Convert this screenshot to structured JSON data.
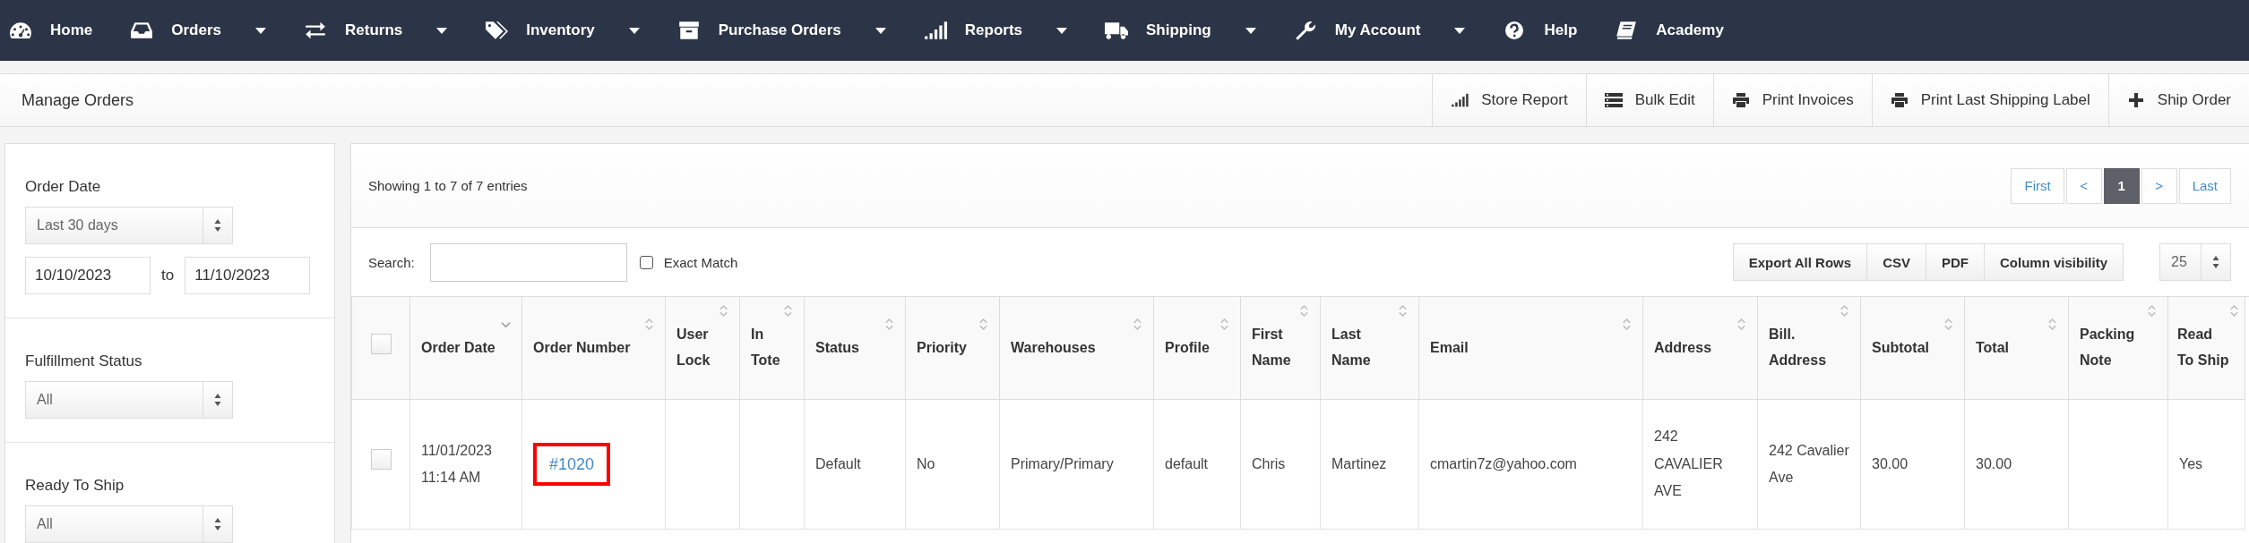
{
  "nav": [
    {
      "label": "Home",
      "dropdown": false
    },
    {
      "label": "Orders",
      "dropdown": true
    },
    {
      "label": "Returns",
      "dropdown": true
    },
    {
      "label": "Inventory",
      "dropdown": true
    },
    {
      "label": "Purchase Orders",
      "dropdown": true
    },
    {
      "label": "Reports",
      "dropdown": true
    },
    {
      "label": "Shipping",
      "dropdown": true
    },
    {
      "label": "My Account",
      "dropdown": true
    },
    {
      "label": "Help",
      "dropdown": false
    },
    {
      "label": "Academy",
      "dropdown": false
    }
  ],
  "page_title": "Manage Orders",
  "toolbar": [
    {
      "label": "Store Report"
    },
    {
      "label": "Bulk Edit"
    },
    {
      "label": "Print Invoices"
    },
    {
      "label": "Print Last Shipping Label"
    },
    {
      "label": "Ship Order"
    }
  ],
  "filters": [
    {
      "label": "Order Date",
      "select": "Last 30 days",
      "from": "10/10/2023",
      "separator": "to",
      "to": "11/10/2023"
    },
    {
      "label": "Fulfillment Status",
      "select": "All"
    },
    {
      "label": "Ready To Ship",
      "select": "All"
    }
  ],
  "info": "Showing 1 to 7 of 7 entries",
  "pagination": [
    {
      "label": "First",
      "selected": false
    },
    {
      "label": "<",
      "selected": false
    },
    {
      "label": "1",
      "selected": true
    },
    {
      "label": ">",
      "selected": false
    },
    {
      "label": "Last",
      "selected": false
    }
  ],
  "search": {
    "label": "Search:"
  },
  "exact_match": {
    "label": "Exact Match",
    "checked": false
  },
  "export_buttons": [
    "Export All Rows",
    "CSV",
    "PDF",
    "Column visibility"
  ],
  "page_size": "25",
  "table": {
    "select_all_checked": false,
    "columns": [
      {
        "label": "Order Date",
        "sorted": true
      },
      {
        "label": "Order Number",
        "sorted": false
      },
      {
        "label": "User Lock",
        "sorted": false
      },
      {
        "label": "In Tote",
        "sorted": false
      },
      {
        "label": "Status",
        "sorted": false
      },
      {
        "label": "Priority",
        "sorted": false
      },
      {
        "label": "Warehouses",
        "sorted": false
      },
      {
        "label": "Profile",
        "sorted": false
      },
      {
        "label": "First Name",
        "sorted": false
      },
      {
        "label": "Last Name",
        "sorted": false
      },
      {
        "label": "Email",
        "sorted": false
      },
      {
        "label": "Address",
        "sorted": false
      },
      {
        "label": "Bill. Address",
        "sorted": false
      },
      {
        "label": "Subtotal",
        "sorted": false
      },
      {
        "label": "Total",
        "sorted": false
      },
      {
        "label": "Packing Note",
        "sorted": false
      },
      {
        "label": "Read To Ship",
        "sorted": false
      }
    ],
    "rows": [
      {
        "checked": false,
        "order_date": "11/01/2023",
        "order_time": "11:14 AM",
        "order_number": "#1020",
        "order_number_highlighted": true,
        "user_lock": "",
        "in_tote": "",
        "status": "Default",
        "priority": "No",
        "warehouses": "Primary/Primary",
        "profile": "default",
        "first_name": "Chris",
        "last_name": "Martinez",
        "email": "cmartin7z@yahoo.com",
        "address": "242 CAVALIER AVE",
        "bill_address": "242 Cavalier Ave",
        "subtotal": "30.00",
        "total": "30.00",
        "packing_note": "",
        "ready_to_ship": "Yes"
      }
    ]
  }
}
